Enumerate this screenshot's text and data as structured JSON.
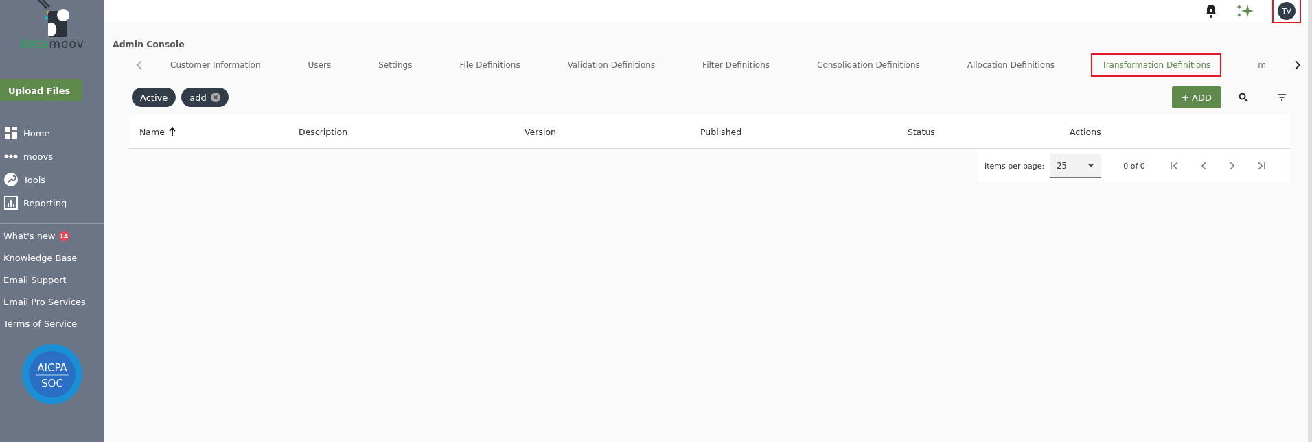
{
  "logo": {
    "brand_first": "deta",
    "brand_second": "moov"
  },
  "sidebar": {
    "upload_button": "Upload Files",
    "nav": [
      {
        "label": "Home",
        "kind": "home"
      },
      {
        "label": "moovs",
        "kind": "moovs"
      },
      {
        "label": "Tools",
        "kind": "tools"
      },
      {
        "label": "Reporting",
        "kind": "reporting"
      }
    ],
    "links": [
      {
        "label": "What's new",
        "badge": "14"
      },
      {
        "label": "Knowledge Base"
      },
      {
        "label": "Email Support"
      },
      {
        "label": "Email Pro Services"
      },
      {
        "label": "Terms of Service"
      }
    ],
    "certification": {
      "title": "AICPA",
      "subtitle": "SOC"
    }
  },
  "topbar": {
    "avatar": {
      "initials": "TV",
      "highlighted": true
    }
  },
  "page_title": "Admin Console",
  "tabs": [
    {
      "label": "Customer Information",
      "selected": false,
      "highlighted": false
    },
    {
      "label": "Users",
      "selected": false,
      "highlighted": false
    },
    {
      "label": "Settings",
      "selected": false,
      "highlighted": false
    },
    {
      "label": "File Definitions",
      "selected": false,
      "highlighted": false
    },
    {
      "label": "Validation Definitions",
      "selected": false,
      "highlighted": false
    },
    {
      "label": "Filter Definitions",
      "selected": false,
      "highlighted": false
    },
    {
      "label": "Consolidation Definitions",
      "selected": false,
      "highlighted": false
    },
    {
      "label": "Allocation Definitions",
      "selected": false,
      "highlighted": false
    },
    {
      "label": "Transformation Definitions",
      "selected": true,
      "highlighted": true
    },
    {
      "label": "m",
      "selected": false,
      "highlighted": false
    }
  ],
  "filters": [
    {
      "label": "Active",
      "removable": false
    },
    {
      "label": "add",
      "removable": true
    }
  ],
  "add_button": "+ ADD",
  "table": {
    "columns": [
      {
        "label": "Name",
        "sorted": true
      },
      {
        "label": "Description",
        "sorted": false
      },
      {
        "label": "Version",
        "sorted": false
      },
      {
        "label": "Published",
        "sorted": false
      },
      {
        "label": "Status",
        "sorted": false
      },
      {
        "label": "Actions",
        "sorted": false
      }
    ]
  },
  "pagination": {
    "items_per_page_label": "Items per page:",
    "page_size": "25",
    "range": "0 of 0"
  }
}
